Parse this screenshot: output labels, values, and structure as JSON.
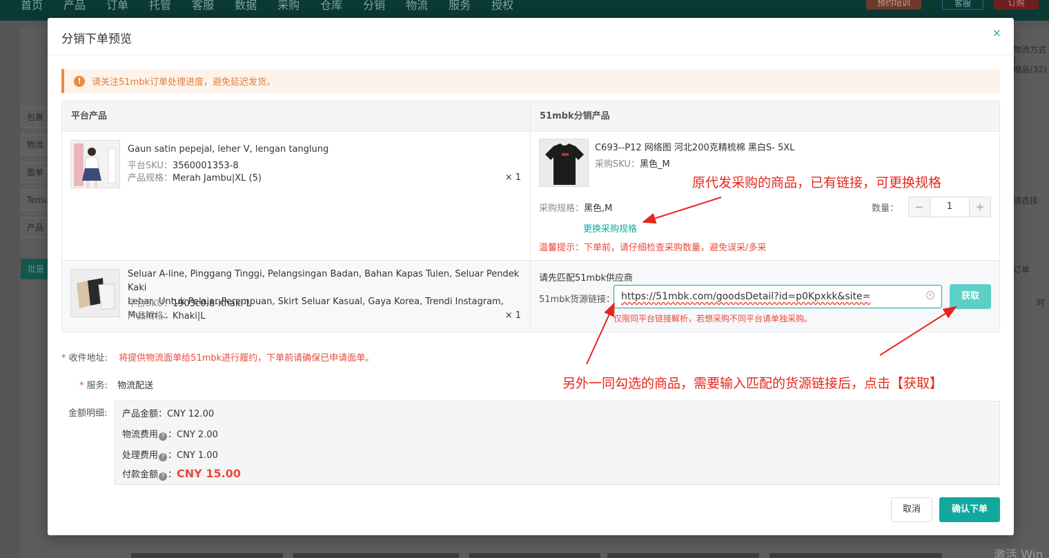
{
  "background": {
    "nav_items": [
      "首页",
      "产品",
      "订单",
      "托管",
      "客服",
      "数据",
      "采购",
      "仓库",
      "分销",
      "物流",
      "服务",
      "授权"
    ],
    "nav_btn1": "预约培训",
    "nav_btn2": "客服",
    "nav_btn3": "订购",
    "left_items": [
      "包裹",
      "物流",
      "面单",
      "Temu",
      "产品"
    ],
    "bulk_btn": "批量",
    "right_texts": [
      "物流方式(",
      "赠品(32)",
      "请选择",
      "订单",
      "时"
    ],
    "watermark": "激活 Win"
  },
  "modal": {
    "title": "分销下单预览",
    "alert": "请关注51mbk订单处理进度，避免延迟发货。",
    "table": {
      "col_left": "平台产品",
      "col_right": "51mbk分销产品",
      "rows": [
        {
          "title": "Gaun satin pepejal, leher V, lengan tanglung",
          "sku_label": "平台SKU：",
          "sku": "3560001353-8",
          "spec_label": "产品规格：",
          "spec": "Merah Jambu|XL (5)",
          "qty": "× 1",
          "dist_title": "C693--P12  网络图  河北200克精梳棉  黑白S- 5XL",
          "dist_sku_label": "采购SKU：",
          "dist_sku": "黑色_M",
          "purchase_spec_label": "采购规格：",
          "purchase_spec": "黑色,M",
          "change_link": "更换采购规格",
          "warn_tip": "温馨提示：下单前，请仔细检查采购数量，避免误采/多采",
          "qty_label": "数量：",
          "qty_value": "1"
        },
        {
          "title_line1": "Seluar A-line, Pinggang Tinggi, Pelangsingan Badan, Bahan Kapas Tulen, Seluar Pendek Kaki",
          "title_line2": "Lebar, Untuk Pelajar Perempuan, Skirt Seluar Kasual, Gaya Korea, Trendi Instagram, Musim ...",
          "sku_label": "平台SKU：",
          "sku": "1903c0-8-Khaki-L",
          "spec_label": "产品规格：",
          "spec": "Khaki|L",
          "qty": "× 1",
          "match_title": "请先匹配51mbk供应商",
          "link_label": "51mbk货源链接：",
          "link_value": "https://51mbk.com/goodsDetail?id=p0Kpxkk&site=",
          "fetch_btn": "获取",
          "hint": "仅限同平台链接解析，若想采购不同平台请单独采购。"
        }
      ]
    },
    "address_label": "收件地址:",
    "address_note": "将提供物流面单给51mbk进行履约，下单前请确保已申请面单。",
    "service_label": "服务:",
    "service_value": "物流配送",
    "amount_label": "金额明细:",
    "amounts": {
      "product_label": "产品金额：",
      "product": "CNY 12.00",
      "logistics_label": "物流费用",
      "logistics": "CNY 2.00",
      "handling_label": "处理费用",
      "handling": "CNY 1.00",
      "pay_label": "付款金额",
      "pay": "CNY 15.00"
    },
    "cancel_btn": "取消",
    "confirm_btn": "确认下单",
    "close_glyph": "×"
  },
  "annotations": {
    "top": "原代发采购的商品，已有链接，可更换规格",
    "bottom": "另外一同勾选的商品，需要输入匹配的货源链接后，点击【获取】"
  },
  "colors": {
    "accent": "#12a89d",
    "warning": "#e84a3c",
    "alert_bg": "#fdf3ea",
    "annotation": "#e8251c"
  }
}
